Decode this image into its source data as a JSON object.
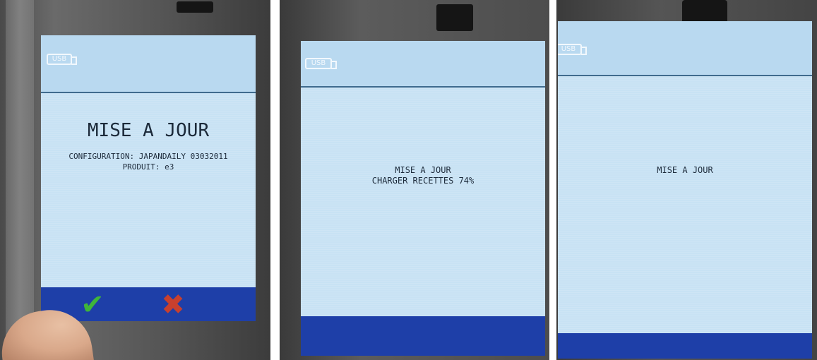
{
  "photos": [
    {
      "usb_label": "USB",
      "title": "MISE A JOUR",
      "line1": "CONFIGURATION: JAPANDAILY 03032011",
      "line2": "PRODUIT: e3",
      "confirm_icon": "check-icon",
      "cancel_icon": "cross-icon",
      "confirm_color": "#3fb53a",
      "cancel_color": "#c8402e"
    },
    {
      "usb_label": "USB",
      "title": "MISE A JOUR",
      "progress_text": "CHARGER RECETTES  74%",
      "progress_percent": 74
    },
    {
      "usb_label": "USB",
      "title": "MISE A JOUR"
    }
  ],
  "colors": {
    "screen": "#c8e2f4",
    "bottom_bar": "#1e3fa8",
    "text": "#1c2a3a"
  }
}
